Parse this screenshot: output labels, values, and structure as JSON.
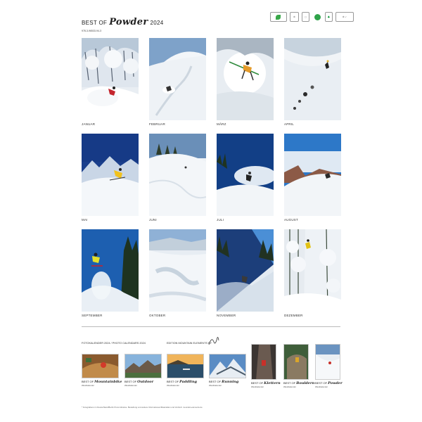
{
  "header": {
    "pre": "BEST OF",
    "brand": "Powder",
    "year": "2024",
    "isbn": "978-3-96533-94-3"
  },
  "months": [
    {
      "label": "JANUAR"
    },
    {
      "label": "FEBRUAR"
    },
    {
      "label": "MÄRZ"
    },
    {
      "label": "APRIL"
    },
    {
      "label": "MAI"
    },
    {
      "label": "JUNI"
    },
    {
      "label": "JULI"
    },
    {
      "label": "AUGUST"
    },
    {
      "label": "SEPTEMBER"
    },
    {
      "label": "OKTOBER"
    },
    {
      "label": "NOVEMBER"
    },
    {
      "label": "DEZEMBER"
    }
  ],
  "bottom": {
    "foto_title": "FOTOKALENDER 2024 / PHOTO CALENDARS 2024",
    "edition": "EDITION MOUNTAIN ELEMENTS BY",
    "calendars": [
      {
        "pre": "BEST OF",
        "name": "Mountainbike",
        "sub": "Wandkalender"
      },
      {
        "pre": "BEST OF",
        "name": "Outdoor",
        "sub": "Wandkalender"
      },
      {
        "pre": "BEST OF",
        "name": "Paddling",
        "sub": "Wandkalender"
      },
      {
        "pre": "BEST OF",
        "name": "Running",
        "sub": "Wandkalender"
      },
      {
        "pre": "BEST OF",
        "name": "Klettern",
        "sub": "Wandkalender"
      },
      {
        "pre": "BEST OF",
        "name": "Bouldern",
        "sub": "Wandkalender"
      },
      {
        "pre": "BEST OF",
        "name": "Powder",
        "sub": "Wandkalender"
      }
    ]
  },
  "footnote": "* Fotografieren in Deutschland/Berlin Preis inklusive. Bestellung und weitere Informationen/Materialien und Vertrieb: mountain-elements.de"
}
